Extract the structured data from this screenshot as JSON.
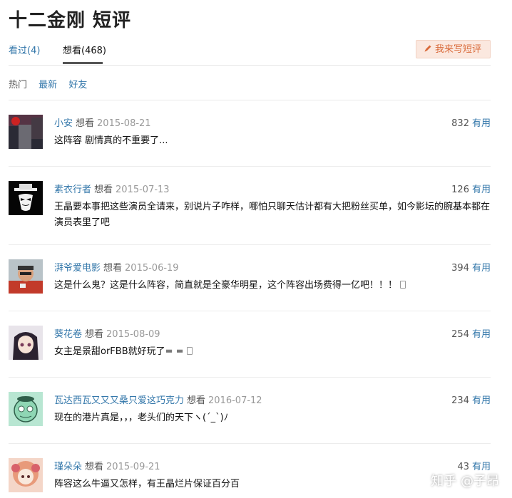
{
  "title": "十二金刚 短评",
  "tabs": [
    {
      "label": "看过(4)"
    },
    {
      "label": "想看(468)"
    }
  ],
  "write_button": {
    "label": "我来写短评",
    "icon": "pencil-icon"
  },
  "filters": [
    {
      "label": "热门"
    },
    {
      "label": "最新"
    },
    {
      "label": "好友"
    }
  ],
  "comments": [
    {
      "user": "小安",
      "status": "想看",
      "date": "2015-08-21",
      "votes": "832",
      "useful_label": "有用",
      "text": "这阵容 剧情真的不重要了..."
    },
    {
      "user": "素衣行者",
      "status": "想看",
      "date": "2015-07-13",
      "votes": "126",
      "useful_label": "有用",
      "text": "王晶要本事把这些演员全请来，别说片子咋样，哪怕只聊天估计都有大把粉丝买单，如今影坛的腕基本都在演员表里了吧"
    },
    {
      "user": "湃爷爱电影",
      "status": "想看",
      "date": "2015-06-19",
      "votes": "394",
      "useful_label": "有用",
      "text": "这是什么鬼？这是什么阵容，简直就是全豪华明星，这个阵容出场费得一亿吧！！！"
    },
    {
      "user": "葵花卷",
      "status": "想看",
      "date": "2015-08-09",
      "votes": "254",
      "useful_label": "有用",
      "text": "女主是景甜orFBB就好玩了= ="
    },
    {
      "user": "瓦达西瓦又又又桑只爱这巧克力",
      "status": "想看",
      "date": "2016-07-12",
      "votes": "234",
      "useful_label": "有用",
      "text": "现在的港片真是，，，老头们的天下ヽ(ˊ_ˋ)ﾉ"
    },
    {
      "user": "瑾朵朵",
      "status": "想看",
      "date": "2015-09-21",
      "votes": "43",
      "useful_label": "有用",
      "text": "阵容这么牛逼又怎样，有王晶烂片保证百分百"
    }
  ],
  "watermark": "知乎 @子昂"
}
